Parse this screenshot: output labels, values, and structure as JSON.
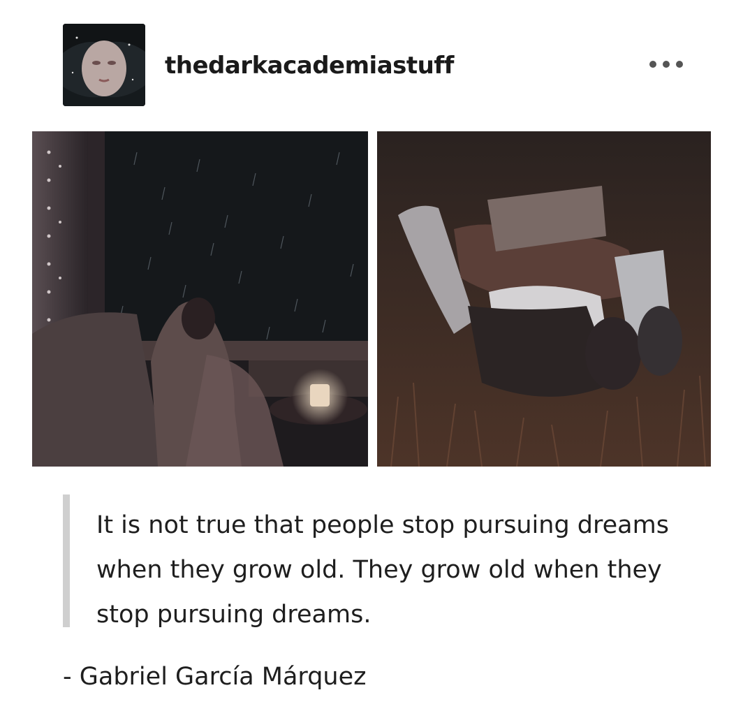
{
  "post": {
    "blog_name": "thedarkacademiastuff",
    "avatar_icon": "avatar-portrait-upside-down",
    "more_icon": "ellipsis-horizontal-icon",
    "photos": [
      {
        "icon": "photo-rainy-window-candle"
      },
      {
        "icon": "photo-person-lying-in-grass-with-book"
      }
    ],
    "quote": {
      "text": "It is not true that people stop pursuing dreams when they grow old. They grow old when they stop pursuing dreams.",
      "attribution": "- Gabriel García Márquez"
    },
    "colors": {
      "quote_border": "#cfcfcf",
      "text": "#1e1e1e",
      "background": "#ffffff"
    }
  }
}
